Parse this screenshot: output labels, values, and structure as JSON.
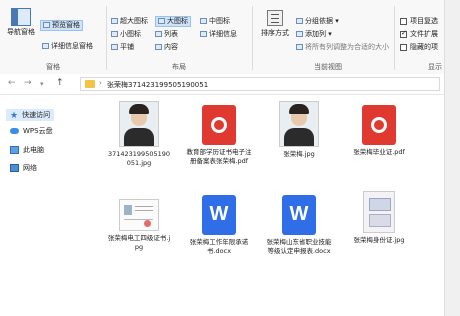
{
  "ribbon": {
    "nav_pane": "导航窗格",
    "preview_pane": "预览窗格",
    "details_pane": "详细信息窗格",
    "group_panes": "窗格",
    "layout_items": [
      "超大图标",
      "大图标",
      "中图标",
      "小图标",
      "列表",
      "详细信息",
      "平铺",
      "内容"
    ],
    "group_layout": "布局",
    "sort_by": "排序方式",
    "group_by": "分组依据",
    "add_column": "添加列",
    "size_all_columns": "将所有列调整为合适的大小",
    "group_current_view": "当前视图",
    "item_checkboxes": "项目复选",
    "file_extensions": "文件扩展",
    "hidden_items": "隐藏的项",
    "group_show": "显示"
  },
  "address": {
    "path": "张荣梅371423199505190051"
  },
  "sidebar": {
    "items": [
      "快速访问",
      "WPS云盘",
      "此电脑",
      "网络"
    ]
  },
  "files": [
    {
      "name": "371423199505190051.jpg",
      "kind": "photo"
    },
    {
      "name": "教育部学历证书电子注册备案表张荣梅.pdf",
      "kind": "pdf"
    },
    {
      "name": "张荣梅.jpg",
      "kind": "photo"
    },
    {
      "name": "张荣梅毕业证.pdf",
      "kind": "pdf"
    },
    {
      "name": "张荣梅电工四级证书.jpg",
      "kind": "cert"
    },
    {
      "name": "张荣梅工作年限承诺书.docx",
      "kind": "docx"
    },
    {
      "name": "张荣梅山东省职业技能等级认定申报表.docx",
      "kind": "docx"
    },
    {
      "name": "张荣梅身份证.jpg",
      "kind": "idcard"
    }
  ],
  "colors": {
    "pdf": "#e0392f",
    "docx": "#2f6ee6",
    "accent": "#99c3ec"
  }
}
